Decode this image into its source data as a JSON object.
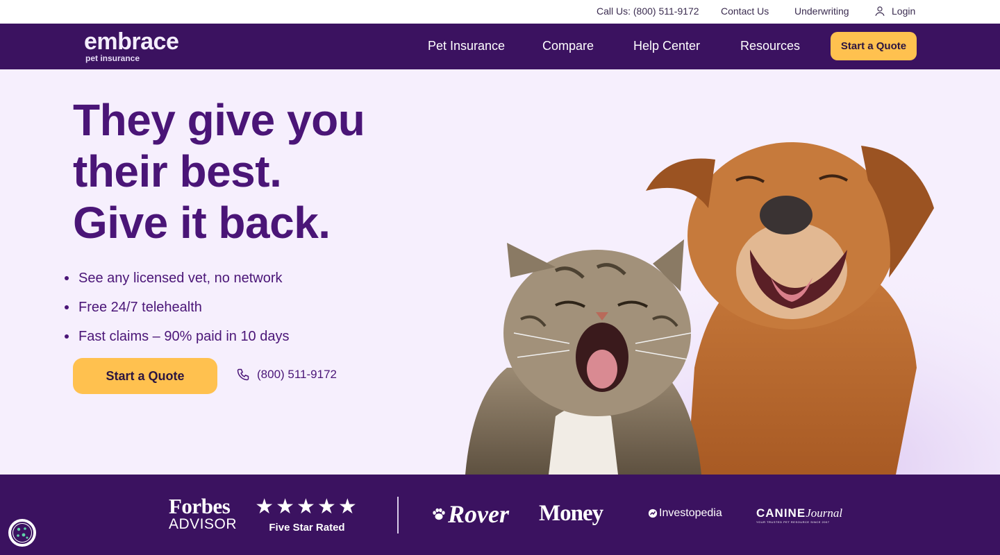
{
  "utility_bar": {
    "call_us": "Call Us: (800) 511-9172",
    "contact_us": "Contact Us",
    "underwriting": "Underwriting",
    "login": "Login"
  },
  "nav": {
    "logo_word": "embrace",
    "logo_sub": "pet insurance",
    "links": [
      "Pet Insurance",
      "Compare",
      "Help Center",
      "Resources"
    ],
    "cta": "Start a Quote"
  },
  "hero": {
    "headline": [
      "They give you",
      "their best.",
      "Give it back."
    ],
    "bullets": [
      "See any licensed vet, no network",
      "Free 24/7 telehealth",
      "Fast claims – 90% paid in 10 days"
    ],
    "cta": "Start a Quote",
    "phone": "(800) 511-9172"
  },
  "trust_bar": {
    "forbes_line1": "Forbes",
    "forbes_line2": "ADVISOR",
    "stars": "★★★★★",
    "star_rating": 5,
    "star_label": "Five Star Rated",
    "rover": "Rover",
    "money": "Money",
    "investopedia": "Investopedia",
    "canine": "CANINE",
    "canine_script": "Journal",
    "canine_tagline": "YOUR TRUSTED PET RESOURCE SINCE 2007"
  },
  "colors": {
    "brand_purple": "#3b1260",
    "headline_purple": "#4a1577",
    "cta_yellow": "#ffc14f",
    "hero_bg": "#f6effd"
  },
  "icons": [
    "user-icon",
    "phone-icon",
    "paw-icon",
    "investopedia-icon",
    "cookie-icon",
    "star-icon"
  ]
}
